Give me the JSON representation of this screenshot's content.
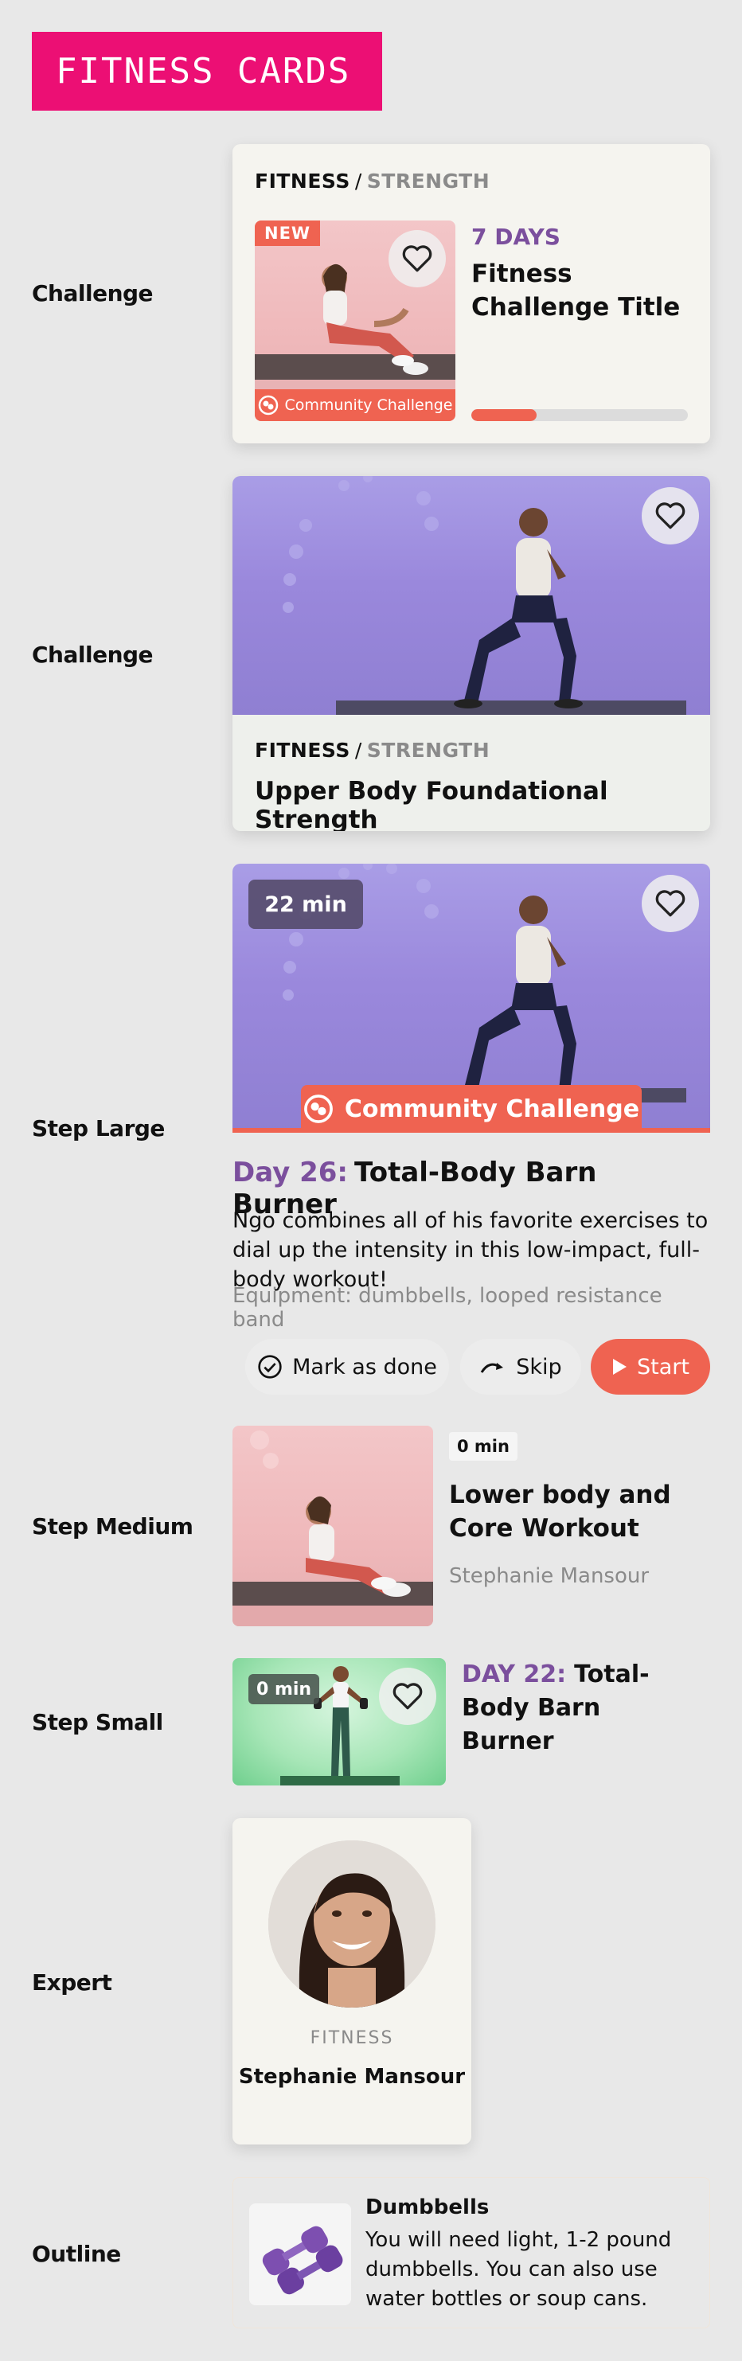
{
  "page": {
    "title": "FITNESS CARDS"
  },
  "labels": {
    "challenge1": "Challenge",
    "challenge2": "Challenge",
    "step_large": "Step Large",
    "step_medium": "Step Medium",
    "step_small": "Step Small",
    "expert": "Expert",
    "outline": "Outline"
  },
  "challenge_card": {
    "category": "FITNESS",
    "separator": "/",
    "subcategory": "STRENGTH",
    "badge": "NEW",
    "ribbon": "Community Challenge",
    "days": "7 DAYS",
    "title": "Fitness Challenge Title",
    "progress": 0.3
  },
  "challenge_card_2": {
    "category": "FITNESS",
    "separator": "/",
    "subcategory": "STRENGTH",
    "title": "Upper Body Foundational Strength"
  },
  "step_large": {
    "duration": "22 min",
    "ribbon": "Community Challenge",
    "day": "Day 26:",
    "title": "Total-Body Barn Burner",
    "description": "Ngo combines all of his favorite exercises to dial up the intensity in this low-impact, full-body workout!",
    "equipment": "Equipment: dumbbells, looped resistance band",
    "mark_done": "Mark as done",
    "skip": "Skip",
    "start": "Start"
  },
  "step_medium": {
    "duration": "0 min",
    "title": "Lower body and Core Workout",
    "author": "Stephanie Mansour"
  },
  "step_small": {
    "duration": "0 min",
    "day": "DAY 22:",
    "title": "Total-Body Barn Burner"
  },
  "expert": {
    "category": "FITNESS",
    "name": "Stephanie Mansour"
  },
  "outline": {
    "title": "Dumbbells",
    "description": "You will need light, 1-2 pound dumbbells. You can also use water bottles or soup cans."
  },
  "colors": {
    "brand_pink": "#ec0f74",
    "purple": "#7b4f9d",
    "coral": "#ef6351",
    "progress_track": "#dcdcdc"
  },
  "icons": [
    "heart-icon",
    "community-icon",
    "check-circle-icon",
    "skip-arrow-icon",
    "play-icon",
    "dumbbell-icon"
  ]
}
